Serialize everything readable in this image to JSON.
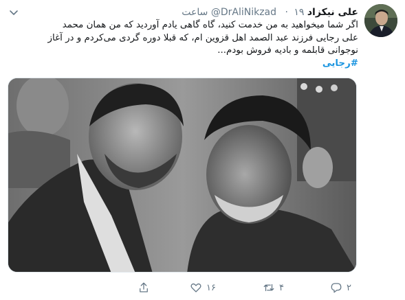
{
  "tweet": {
    "author_name": "علی نیکزاد",
    "handle": "@DrAliNikzad",
    "time": "۱۹ ساعت",
    "lines": [
      "اگر شما میخواهید به من خدمت کنید، گاه گاهی یادم آوردید که من همان محمد",
      "علی رجایی فرزند عبد الصمد اهل قزوین ام، که قبلا دوره گردی می‌کردم و در آغاز",
      "نوجوانی قابلمه و بادیه فروش بودم..."
    ],
    "hashtag": "#رجایی",
    "likes": "۱۶",
    "retweets": "۴",
    "replies": "۲"
  },
  "icons": {
    "reply": "reply-icon",
    "retweet": "retweet-icon",
    "like": "heart-icon",
    "share": "share-icon",
    "menu": "chevron-down-icon"
  },
  "colors": {
    "link": "#1b95e0",
    "muted": "#657786",
    "text": "#14171a"
  }
}
